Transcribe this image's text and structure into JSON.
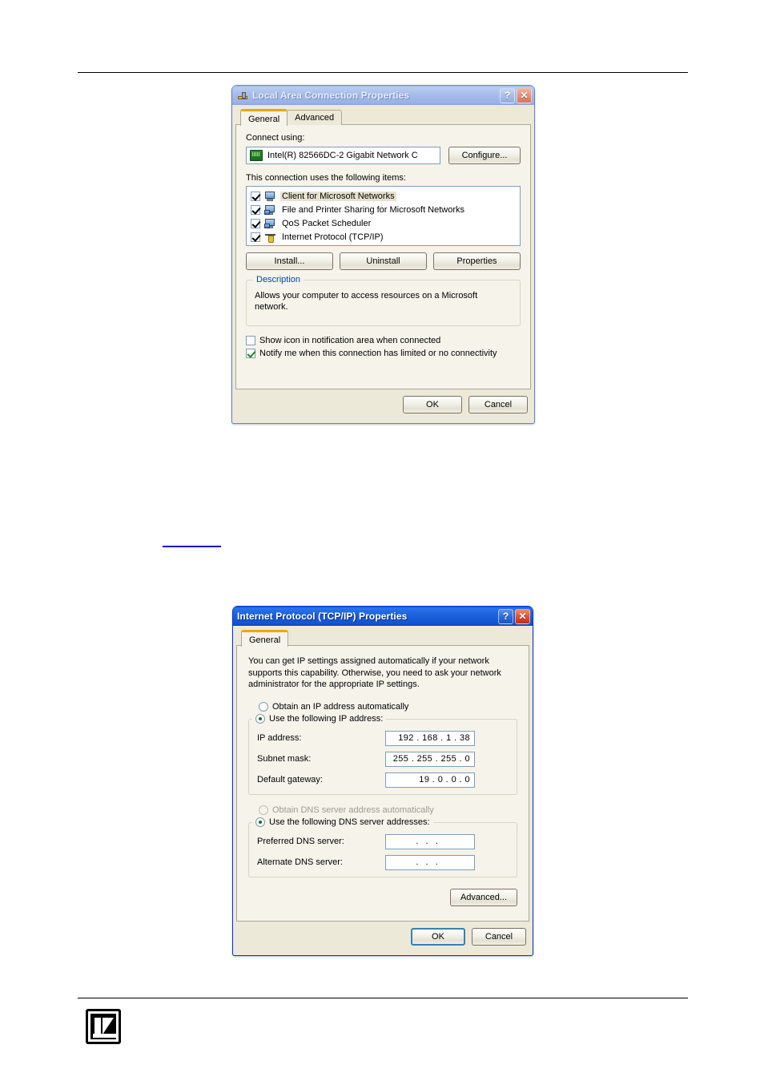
{
  "page": {
    "background": "#ffffff",
    "link_underline_color": "#0000cc",
    "logo_name": "kramer-logo"
  },
  "dialog_lan": {
    "title": "Local Area Connection Properties",
    "title_icon": "network-connection-icon",
    "help_button": "?",
    "close_button": "✕",
    "tabs": [
      {
        "label": "General",
        "selected": true
      },
      {
        "label": "Advanced",
        "selected": false
      }
    ],
    "connect_using_label": "Connect using:",
    "adapter": {
      "icon": "network-adapter-icon",
      "text": "Intel(R) 82566DC-2 Gigabit Network C"
    },
    "configure_button": "Configure...",
    "items_label": "This connection uses the following items:",
    "items": [
      {
        "label": "Client for Microsoft Networks",
        "checked": true,
        "selected": true,
        "icon": "computer-network-icon"
      },
      {
        "label": "File and Printer Sharing for Microsoft Networks",
        "checked": true,
        "selected": false,
        "icon": "file-print-sharing-icon"
      },
      {
        "label": "QoS Packet Scheduler",
        "checked": true,
        "selected": false,
        "icon": "qos-scheduler-icon"
      },
      {
        "label": "Internet Protocol (TCP/IP)",
        "checked": true,
        "selected": false,
        "icon": "tcpip-protocol-icon"
      }
    ],
    "install_button": "Install...",
    "uninstall_button": "Uninstall",
    "properties_button": "Properties",
    "description_group_title": "Description",
    "description_text": "Allows your computer to access resources on a Microsoft network.",
    "show_icon_checkbox": {
      "label": "Show icon in notification area when connected",
      "checked": false
    },
    "notify_checkbox": {
      "label": "Notify me when this connection has limited or no connectivity",
      "checked": true
    },
    "ok_button": "OK",
    "cancel_button": "Cancel"
  },
  "dialog_tcpip": {
    "title": "Internet Protocol (TCP/IP) Properties",
    "help_button": "?",
    "close_button": "✕",
    "tabs": [
      {
        "label": "General",
        "selected": true
      }
    ],
    "intro_text": "You can get IP settings assigned automatically if your network supports this capability. Otherwise, you need to ask your network administrator for the appropriate IP settings.",
    "obtain_ip_radio": {
      "label": "Obtain an IP address automatically",
      "selected": false
    },
    "use_ip_radio": {
      "label": "Use the following IP address:",
      "selected": true
    },
    "ip_fields": [
      {
        "label": "IP address:",
        "value": "192 . 168 .  1  .  38"
      },
      {
        "label": "Subnet mask:",
        "value": "255 . 255 . 255 .  0"
      },
      {
        "label": "Default gateway:",
        "value": " 19 .  0  .  0  .  0"
      }
    ],
    "obtain_dns_radio": {
      "label": "Obtain DNS server address automatically",
      "selected": false,
      "disabled": true
    },
    "use_dns_radio": {
      "label": "Use the following DNS server addresses:",
      "selected": true
    },
    "dns_fields": [
      {
        "label": "Preferred DNS server:",
        "value": ".    .    ."
      },
      {
        "label": "Alternate DNS server:",
        "value": ".    .    ."
      }
    ],
    "advanced_button": "Advanced...",
    "ok_button": "OK",
    "cancel_button": "Cancel"
  }
}
